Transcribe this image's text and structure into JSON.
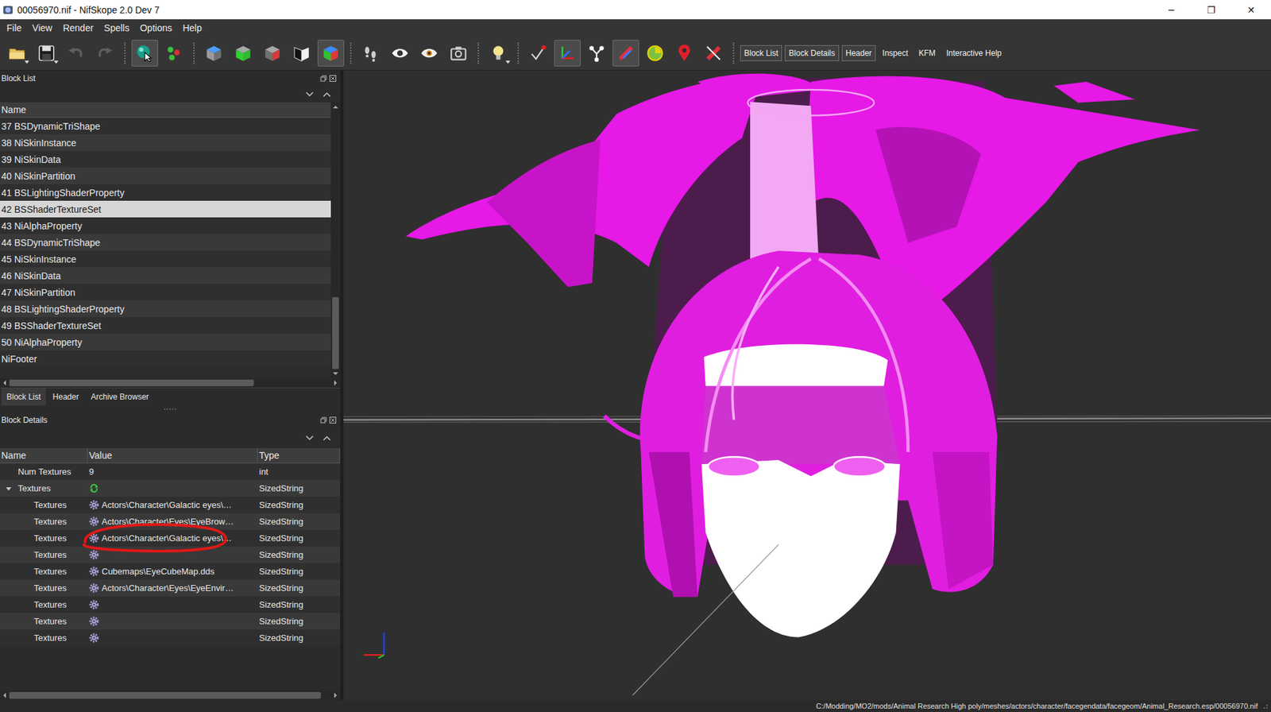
{
  "window": {
    "title": "00056970.nif - NifSkope 2.0 Dev 7",
    "controls": [
      "─",
      "❐",
      "✕"
    ]
  },
  "menu": [
    "File",
    "View",
    "Render",
    "Spells",
    "Options",
    "Help"
  ],
  "toolbar": {
    "groups": [
      [
        {
          "kind": "open",
          "pressed": false,
          "disabled": false,
          "dropdown": true
        },
        {
          "kind": "save",
          "pressed": false,
          "disabled": false,
          "dropdown": true
        },
        {
          "kind": "undo",
          "pressed": false,
          "disabled": true,
          "dropdown": false
        },
        {
          "kind": "redo",
          "pressed": false,
          "disabled": true,
          "dropdown": false
        }
      ],
      [
        {
          "kind": "select",
          "pressed": true,
          "disabled": false,
          "dropdown": false
        },
        {
          "kind": "select-multi",
          "pressed": false,
          "disabled": false,
          "dropdown": false
        }
      ],
      [
        {
          "kind": "view-top",
          "pressed": false,
          "disabled": false,
          "dropdown": false
        },
        {
          "kind": "view-front",
          "pressed": false,
          "disabled": false,
          "dropdown": false
        },
        {
          "kind": "view-side",
          "pressed": false,
          "disabled": false,
          "dropdown": false
        },
        {
          "kind": "view-flip",
          "pressed": false,
          "disabled": false,
          "dropdown": false
        },
        {
          "kind": "view-user",
          "pressed": true,
          "disabled": false,
          "dropdown": false
        }
      ],
      [
        {
          "kind": "walk",
          "pressed": false,
          "disabled": false,
          "dropdown": false
        },
        {
          "kind": "show-hidden",
          "pressed": false,
          "disabled": false,
          "dropdown": false
        },
        {
          "kind": "show-nodes",
          "pressed": false,
          "disabled": false,
          "dropdown": false
        },
        {
          "kind": "screenshot",
          "pressed": false,
          "disabled": false,
          "dropdown": false
        }
      ],
      [
        {
          "kind": "light",
          "pressed": false,
          "disabled": false,
          "dropdown": true
        }
      ],
      [
        {
          "kind": "vertex",
          "pressed": false,
          "disabled": false,
          "dropdown": false
        },
        {
          "kind": "axes",
          "pressed": true,
          "disabled": false,
          "dropdown": false
        },
        {
          "kind": "nodes",
          "pressed": false,
          "disabled": false,
          "dropdown": false
        },
        {
          "kind": "constraints",
          "pressed": true,
          "disabled": false,
          "dropdown": false
        },
        {
          "kind": "animate",
          "pressed": false,
          "disabled": false,
          "dropdown": false
        },
        {
          "kind": "marker",
          "pressed": false,
          "disabled": false,
          "dropdown": false
        },
        {
          "kind": "no-draw",
          "pressed": false,
          "disabled": false,
          "dropdown": false
        }
      ]
    ],
    "toggles": [
      {
        "label": "Block List",
        "checked": true
      },
      {
        "label": "Block Details",
        "checked": true
      },
      {
        "label": "Header",
        "checked": true
      },
      {
        "label": "Inspect",
        "checked": false
      },
      {
        "label": "KFM",
        "checked": false
      },
      {
        "label": "Interactive Help",
        "checked": false
      }
    ]
  },
  "blockList": {
    "title": "Block List",
    "column": "Name",
    "rows": [
      {
        "label": "37 BSDynamicTriShape",
        "selected": false
      },
      {
        "label": "38 NiSkinInstance",
        "selected": false
      },
      {
        "label": "39 NiSkinData",
        "selected": false
      },
      {
        "label": "40 NiSkinPartition",
        "selected": false
      },
      {
        "label": "41 BSLightingShaderProperty",
        "selected": false
      },
      {
        "label": "42 BSShaderTextureSet",
        "selected": true
      },
      {
        "label": "43 NiAlphaProperty",
        "selected": false
      },
      {
        "label": "44 BSDynamicTriShape",
        "selected": false
      },
      {
        "label": "45 NiSkinInstance",
        "selected": false
      },
      {
        "label": "46 NiSkinData",
        "selected": false
      },
      {
        "label": "47 NiSkinPartition",
        "selected": false
      },
      {
        "label": "48 BSLightingShaderProperty",
        "selected": false
      },
      {
        "label": "49 BSShaderTextureSet",
        "selected": false
      },
      {
        "label": "50 NiAlphaProperty",
        "selected": false
      },
      {
        "label": "NiFooter",
        "selected": false
      }
    ],
    "vscroll": {
      "start": 0.72,
      "size": 0.28
    },
    "hscroll": {
      "start": 0.0,
      "size": 0.76
    }
  },
  "tabs": [
    {
      "label": "Block List",
      "selected": true
    },
    {
      "label": "Header",
      "selected": false
    },
    {
      "label": "Archive Browser",
      "selected": false
    }
  ],
  "blockDetails": {
    "title": "Block Details",
    "columns": [
      "Name",
      "Value",
      "Type"
    ],
    "rows": [
      {
        "kind": "field",
        "name": "Num Textures",
        "value": "9",
        "type": "int"
      },
      {
        "kind": "array",
        "name": "Textures",
        "value": "",
        "type": "SizedString",
        "expanded": true
      },
      {
        "kind": "item",
        "name": "Textures",
        "value": "Actors\\Character\\Galactic eyes\\…",
        "type": "SizedString",
        "circled": false
      },
      {
        "kind": "item",
        "name": "Textures",
        "value": "Actors\\Character\\Eyes\\EyeBrow…",
        "type": "SizedString",
        "circled": false
      },
      {
        "kind": "item",
        "name": "Textures",
        "value": "Actors\\Character\\Galactic eyes\\…",
        "type": "SizedString",
        "circled": true
      },
      {
        "kind": "item",
        "name": "Textures",
        "value": "",
        "type": "SizedString",
        "circled": false
      },
      {
        "kind": "item",
        "name": "Textures",
        "value": "Cubemaps\\EyeCubeMap.dds",
        "type": "SizedString",
        "circled": false
      },
      {
        "kind": "item",
        "name": "Textures",
        "value": "Actors\\Character\\Eyes\\EyeEnvir…",
        "type": "SizedString",
        "circled": false
      },
      {
        "kind": "item",
        "name": "Textures",
        "value": "",
        "type": "SizedString",
        "circled": false
      },
      {
        "kind": "item",
        "name": "Textures",
        "value": "",
        "type": "SizedString",
        "circled": false
      },
      {
        "kind": "item",
        "name": "Textures",
        "value": "",
        "type": "SizedString",
        "circled": false
      }
    ],
    "hscroll": {
      "start": 0.0,
      "size": 0.97
    }
  },
  "status": {
    "path": "C:/Modding/MO2/mods/Animal Research High poly/meshes/actors/character/facegendata/facegeom/Animal_Research.esp/00056970.nif"
  }
}
